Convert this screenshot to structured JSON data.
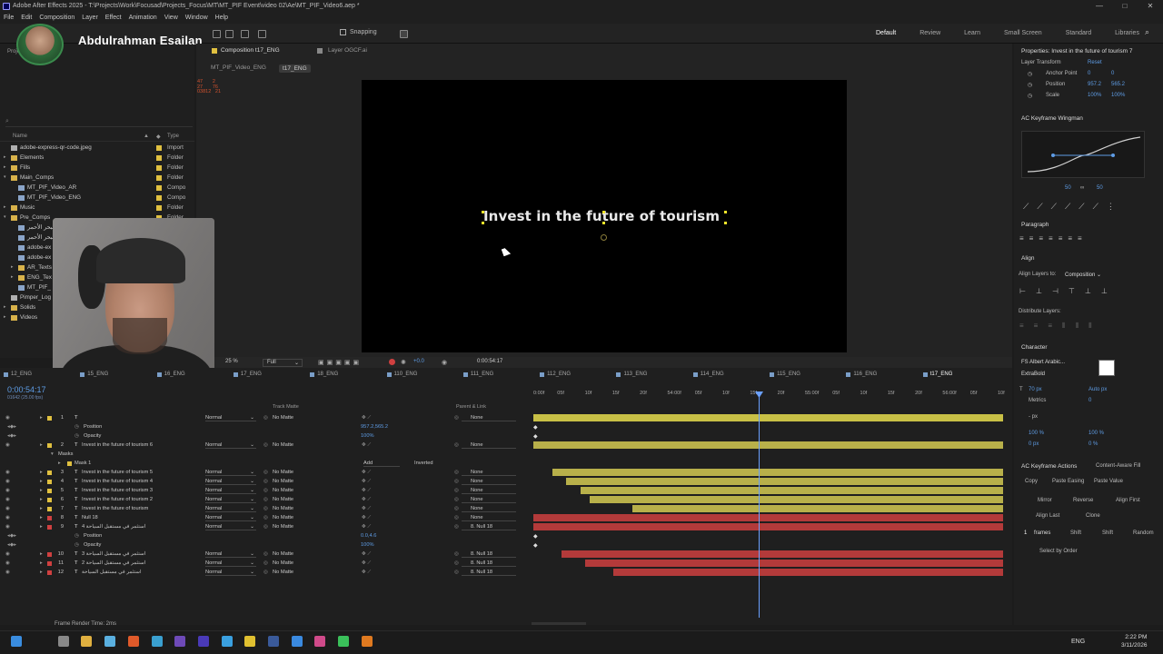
{
  "window": {
    "title": "Adobe After Effects 2025 - T:\\Projects\\Work\\Focusad\\Projects_Focus\\MT\\MT_PIF Event\\video 02\\Ae\\MT_PIF_Video6.aep *",
    "controls": [
      "—",
      "□",
      "✕"
    ]
  },
  "menu": [
    "File",
    "Edit",
    "Composition",
    "Layer",
    "Effect",
    "Animation",
    "View",
    "Window",
    "Help"
  ],
  "toolbar": {
    "snapping_label": "Snapping",
    "workspaces": [
      "Default",
      "Review",
      "Learn",
      "Small Screen",
      "Standard",
      "Libraries"
    ],
    "active_workspace": "Default"
  },
  "user": {
    "name": "Abdulrahman Esailan"
  },
  "project": {
    "tab_label": "Project",
    "search_placeholder": "",
    "col_name": "Name",
    "col_type": "Type",
    "items": [
      {
        "name": "adobe-express-qr-code.jpeg",
        "type": "Import",
        "color": "#e0c040",
        "level": 0,
        "kind": "image",
        "tri": ""
      },
      {
        "name": "Elements",
        "type": "Folder",
        "color": "#e0c040",
        "level": 0,
        "kind": "folder",
        "tri": "▸"
      },
      {
        "name": "Fills",
        "type": "Folder",
        "color": "#e0c040",
        "level": 0,
        "kind": "folder",
        "tri": "▸"
      },
      {
        "name": "Main_Comps",
        "type": "Folder",
        "color": "#e0c040",
        "level": 0,
        "kind": "folder",
        "tri": "▾"
      },
      {
        "name": "MT_PIF_Video_AR",
        "type": "Compo",
        "color": "#e0c040",
        "level": 1,
        "kind": "comp",
        "tri": ""
      },
      {
        "name": "MT_PIF_Video_ENG",
        "type": "Compo",
        "color": "#e0c040",
        "level": 1,
        "kind": "comp",
        "tri": ""
      },
      {
        "name": "Music",
        "type": "Folder",
        "color": "#e0c040",
        "level": 0,
        "kind": "folder",
        "tri": "▸"
      },
      {
        "name": "Pre_Comps",
        "type": "Folder",
        "color": "#e0c040",
        "level": 0,
        "kind": "folder",
        "tri": "▾"
      },
      {
        "name": "البحر الأحمر",
        "type": "",
        "color": "#e0c040",
        "level": 1,
        "kind": "comp",
        "tri": ""
      },
      {
        "name": "البحر الأحمر",
        "type": "",
        "color": "#e0c040",
        "level": 1,
        "kind": "comp",
        "tri": ""
      },
      {
        "name": "adobe-ex",
        "type": "",
        "color": "#e0c040",
        "level": 1,
        "kind": "comp",
        "tri": ""
      },
      {
        "name": "adobe-ex",
        "type": "",
        "color": "#e0c040",
        "level": 1,
        "kind": "comp",
        "tri": ""
      },
      {
        "name": "AR_Texts",
        "type": "",
        "color": "#e0c040",
        "level": 1,
        "kind": "folder",
        "tri": "▸"
      },
      {
        "name": "ENG_Tex",
        "type": "",
        "color": "#e0c040",
        "level": 1,
        "kind": "folder",
        "tri": "▸"
      },
      {
        "name": "MT_PIF_",
        "type": "",
        "color": "#e0c040",
        "level": 1,
        "kind": "comp",
        "tri": ""
      },
      {
        "name": "Pimper_Log",
        "type": "",
        "color": "#e0c040",
        "level": 0,
        "kind": "image",
        "tri": ""
      },
      {
        "name": "Solids",
        "type": "",
        "color": "#e0c040",
        "level": 0,
        "kind": "folder",
        "tri": "▸"
      },
      {
        "name": "Videos",
        "type": "",
        "color": "#e0c040",
        "level": 0,
        "kind": "folder",
        "tri": "▸"
      }
    ]
  },
  "composition": {
    "tab_label": "Composition t17_ENG",
    "layer_tab_label": "Layer OGCF.ai",
    "breadcrumbs": [
      "MT_PIF_Video_ENG",
      "t17_ENG"
    ],
    "stats": [
      "47",
      "2",
      "27",
      "76",
      "03812",
      "21"
    ],
    "text": "Invest in the future of tourism",
    "zoom": "25 %",
    "resolution": "Full",
    "current_time": "0:00:54:17"
  },
  "properties": {
    "title": "Properties: Invest in the future of tourism 7",
    "layer_transform": "Layer Transform",
    "reset": "Reset",
    "rows": [
      {
        "label": "Anchor Point",
        "v1": "0",
        "v2": "0"
      },
      {
        "label": "Position",
        "v1": "957.2",
        "v2": "565.2"
      },
      {
        "label": "Scale",
        "v1": "100%",
        "v2": "100%"
      }
    ],
    "wingman_title": "AC Keyframe Wingman",
    "wingman_vals": [
      "50",
      "50"
    ],
    "paragraph_title": "Paragraph",
    "align_title": "Align",
    "align_to_label": "Align Layers to:",
    "align_to_value": "Composition",
    "distribute_label": "Distribute Layers:",
    "character_title": "Character",
    "font_name": "FS Albert Arabic...",
    "font_style": "ExtraBold",
    "font_size": "70 px",
    "tracking": "Auto px",
    "metrics": "Metrics",
    "leading": "0",
    "stroke": "- px",
    "v_scale": "100 %",
    "h_scale": "100 %",
    "baseline": "0 px",
    "tsume": "0 %",
    "actions_title": "AC Keyframe Actions",
    "content_aware": "Content-Aware Fill",
    "actions": [
      "Copy",
      "Paste Easing",
      "Paste Value",
      "Mirror",
      "Reverse",
      "Align First",
      "Align Last",
      "Align Last",
      "Clone",
      "frames",
      "Shift",
      "Shift",
      "Random",
      "Select by Order"
    ],
    "frames_value": "1"
  },
  "timeline": {
    "tabs": [
      "12_ENG",
      "15_ENG",
      "16_ENG",
      "17_ENG",
      "18_ENG",
      "110_ENG",
      "111_ENG",
      "112_ENG",
      "113_ENG",
      "114_ENG",
      "115_ENG",
      "116_ENG",
      "t17_ENG"
    ],
    "active_tab": "t17_ENG",
    "timecode": "0:00:54:17",
    "frames": "01642 (25.00 fps)",
    "ruler": [
      "0:00f",
      "05f",
      "10f",
      "15f",
      "20f",
      "54:00f",
      "05f",
      "10f",
      "15f",
      "20f",
      "55:00f",
      "05f",
      "10f",
      "15f",
      "20f",
      "56:00f",
      "05f",
      "10f"
    ],
    "col_track_matte": "Track Matte",
    "col_parent": "Parent & Link",
    "status": "Frame Render Time: 2ms",
    "layers": [
      {
        "type": "layer",
        "num": "1",
        "name": "",
        "mode": "Normal",
        "matte": "No Matte",
        "parent": "None",
        "color": "#e0c040",
        "bar_start": 0,
        "bar_end": 1,
        "bar_color": "#c8c046"
      },
      {
        "type": "prop",
        "name": "Position",
        "value": "957.2,565.2"
      },
      {
        "type": "prop",
        "name": "Opacity",
        "value": "100%"
      },
      {
        "type": "layer",
        "num": "2",
        "name": "Invest in the future of tourism 6",
        "mode": "Normal",
        "matte": "No Matte",
        "parent": "None",
        "color": "#e0c040",
        "bar_start": 0,
        "bar_end": 1,
        "bar_color": "#b8b04a"
      },
      {
        "type": "group",
        "name": "Masks"
      },
      {
        "type": "mask",
        "name": "Mask 1",
        "mode": "Add",
        "inverted": "Inverted"
      },
      {
        "type": "layer",
        "num": "3",
        "name": "Invest in the future of tourism 5",
        "mode": "Normal",
        "matte": "No Matte",
        "parent": "None",
        "color": "#e0c040",
        "bar_start": 0.04,
        "bar_end": 1,
        "bar_color": "#b8b04a"
      },
      {
        "type": "layer",
        "num": "4",
        "name": "Invest in the future of tourism 4",
        "mode": "Normal",
        "matte": "No Matte",
        "parent": "None",
        "color": "#e0c040",
        "bar_start": 0.07,
        "bar_end": 1,
        "bar_color": "#b8b04a"
      },
      {
        "type": "layer",
        "num": "5",
        "name": "Invest in the future of tourism 3",
        "mode": "Normal",
        "matte": "No Matte",
        "parent": "None",
        "color": "#e0c040",
        "bar_start": 0.1,
        "bar_end": 1,
        "bar_color": "#b8b04a"
      },
      {
        "type": "layer",
        "num": "6",
        "name": "Invest in the future of tourism 2",
        "mode": "Normal",
        "matte": "No Matte",
        "parent": "None",
        "color": "#e0c040",
        "bar_start": 0.12,
        "bar_end": 1,
        "bar_color": "#b8b04a"
      },
      {
        "type": "layer",
        "num": "7",
        "name": "Invest in the future of tourism",
        "mode": "Normal",
        "matte": "No Matte",
        "parent": "None",
        "color": "#e0c040",
        "bar_start": 0.21,
        "bar_end": 1,
        "bar_color": "#b8b04a"
      },
      {
        "type": "layer",
        "num": "8",
        "name": "Null 18",
        "mode": "Normal",
        "matte": "No Matte",
        "parent": "None",
        "color": "#d04040",
        "bar_start": 0,
        "bar_end": 1,
        "bar_color": "#b33a3a"
      },
      {
        "type": "layer",
        "num": "9",
        "name": "استثمر في مستقبل السياحة 4",
        "mode": "Normal",
        "matte": "No Matte",
        "parent": "8. Null 18",
        "color": "#d04040",
        "bar_start": 0,
        "bar_end": 1,
        "bar_color": "#b33a3a"
      },
      {
        "type": "prop",
        "name": "Position",
        "value": "0.0,4.6"
      },
      {
        "type": "prop",
        "name": "Opacity",
        "value": "100%"
      },
      {
        "type": "layer",
        "num": "10",
        "name": "استثمر في مستقبل السياحة 3",
        "mode": "Normal",
        "matte": "No Matte",
        "parent": "8. Null 18",
        "color": "#d04040",
        "bar_start": 0.06,
        "bar_end": 1,
        "bar_color": "#b33a3a"
      },
      {
        "type": "layer",
        "num": "11",
        "name": "استثمر في مستقبل السياحة 2",
        "mode": "Normal",
        "matte": "No Matte",
        "parent": "8. Null 18",
        "color": "#d04040",
        "bar_start": 0.11,
        "bar_end": 1,
        "bar_color": "#b33a3a"
      },
      {
        "type": "layer",
        "num": "12",
        "name": "استثمر في مستقبل السياحة",
        "mode": "Normal",
        "matte": "No Matte",
        "parent": "8. Null 18",
        "color": "#d04040",
        "bar_start": 0.17,
        "bar_end": 1,
        "bar_color": "#b33a3a"
      }
    ]
  },
  "taskbar": {
    "apps": [
      "windows-icon",
      "task-view-icon",
      "file-explorer-icon",
      "app-icon",
      "brave-icon",
      "chrome-alt-icon",
      "premiere-icon",
      "after-effects-icon",
      "telegram-icon",
      "chrome-icon",
      "steam-icon",
      "notes-icon",
      "instagram-icon",
      "whatsapp-icon",
      "illustrator-icon"
    ],
    "lang": "ENG",
    "time": "2:22 PM",
    "date": "3/11/2026"
  }
}
